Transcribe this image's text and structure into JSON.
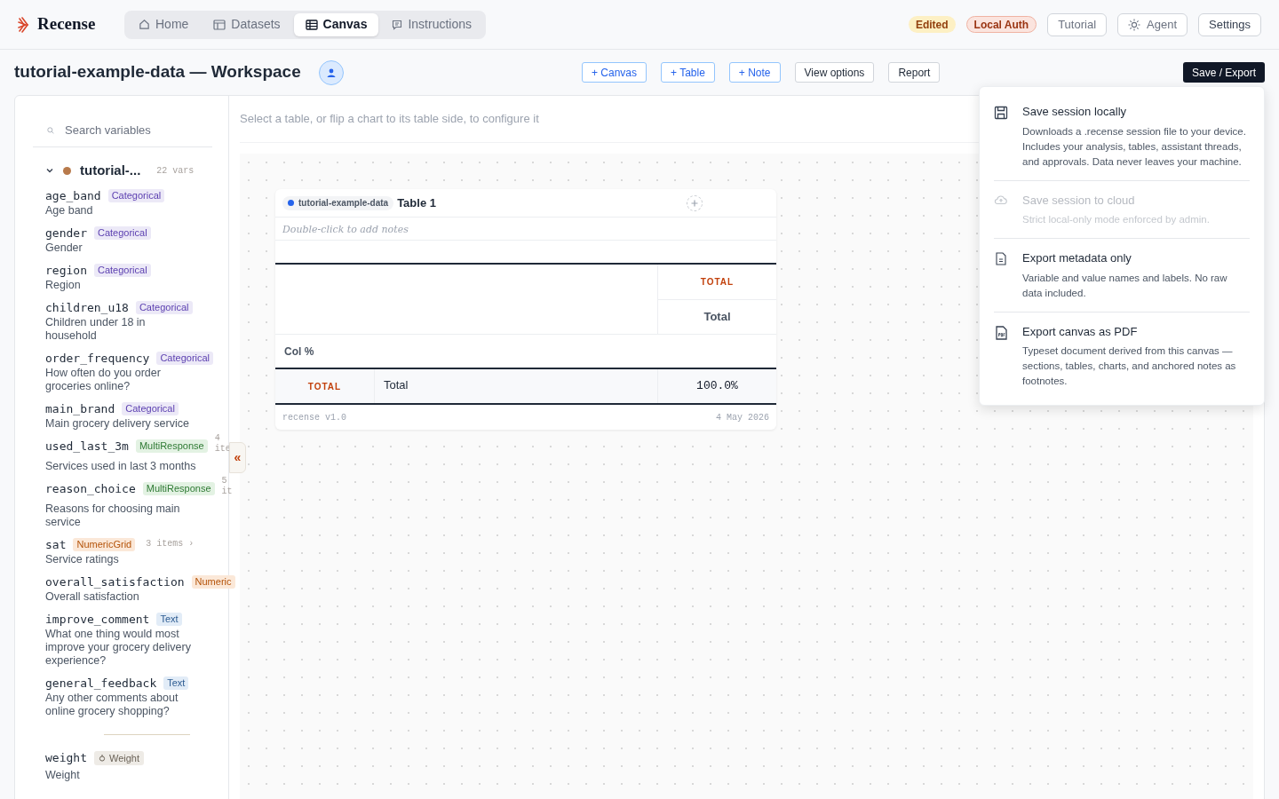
{
  "app": {
    "name": "Recense"
  },
  "nav_tabs": [
    {
      "label": "Home",
      "selected": false
    },
    {
      "label": "Datasets",
      "selected": false
    },
    {
      "label": "Canvas",
      "selected": true
    },
    {
      "label": "Instructions",
      "selected": false
    }
  ],
  "status_badges": [
    {
      "label": "Edited",
      "kind": "warning"
    },
    {
      "label": "Local Auth",
      "kind": "danger"
    }
  ],
  "header_buttons": [
    {
      "label": "Tutorial"
    },
    {
      "label": "Agent"
    },
    {
      "label": "Settings"
    }
  ],
  "workspace": {
    "title": "tutorial-example-data — Workspace"
  },
  "toolbar": [
    {
      "label": "+ Canvas",
      "kind": "add"
    },
    {
      "label": "+ Table",
      "kind": "add"
    },
    {
      "label": "+ Note",
      "kind": "add"
    },
    {
      "label": "View options",
      "kind": "plain"
    },
    {
      "label": "Report",
      "kind": "plain"
    }
  ],
  "save_export": {
    "label": "Save / Export"
  },
  "sidebar": {
    "search": {
      "placeholder": "Search variables"
    },
    "dataset": {
      "name": "tutorial-...",
      "count": "22 vars",
      "color": "#b87a4b",
      "expanded": true
    },
    "variables": [
      {
        "name": "age_band",
        "type": "Categorical",
        "label": "Age band"
      },
      {
        "name": "gender",
        "type": "Categorical",
        "label": "Gender"
      },
      {
        "name": "region",
        "type": "Categorical",
        "label": "Region"
      },
      {
        "name": "children_u18",
        "type": "Categorical",
        "label": "Children under 18 in household"
      },
      {
        "name": "order_frequency",
        "type": "Categorical",
        "label": "How often do you order groceries online?"
      },
      {
        "name": "main_brand",
        "type": "Categorical",
        "label": "Main grocery delivery service"
      },
      {
        "name": "used_last_3m",
        "type": "MultiResponse",
        "label": "Services used in last 3 months",
        "items": "4 ite"
      },
      {
        "name": "reason_choice",
        "type": "MultiResponse",
        "label": "Reasons for choosing main service",
        "items": "5 it"
      },
      {
        "name": "sat",
        "type": "NumericGrid",
        "label": "Service ratings",
        "items": "3 items ›"
      },
      {
        "name": "overall_satisfaction",
        "type": "Numeric",
        "label": "Overall satisfaction"
      },
      {
        "name": "improve_comment",
        "type": "Text",
        "label": "What one thing would most improve your grocery delivery experience?"
      },
      {
        "name": "general_feedback",
        "type": "Text",
        "label": "Any other comments about online grocery shopping?"
      }
    ],
    "weight": {
      "name": "weight",
      "badge": "Weight",
      "label": "Weight"
    },
    "collapse": {
      "label": "«"
    }
  },
  "canvas": {
    "hint": "Select a table, or flip a chart to its table side, to configure it",
    "table_card": {
      "source": "tutorial-example-data",
      "title": "Table 1",
      "notes": {
        "placeholder": "Double-click to add notes"
      },
      "column_group": "TOTAL",
      "column": "Total",
      "statistic": "Col %",
      "row_group": "TOTAL",
      "row": "Total",
      "value": "100.0%",
      "footer_left": "recense v1.0",
      "footer_right": "4 May 2026"
    }
  },
  "export_menu": [
    {
      "kind": "save",
      "title": "Save session locally",
      "description": "Downloads a .recense session file to your device. Includes your analysis, tables, assistant threads, and approvals. Data never leaves your machine.",
      "disabled": false
    },
    {
      "kind": "cloud",
      "title": "Save session to cloud",
      "description": "Strict local-only mode enforced by admin.",
      "disabled": true
    },
    {
      "kind": "metadata",
      "title": "Export metadata only",
      "description": "Variable and value names and labels. No raw data included.",
      "disabled": false
    },
    {
      "kind": "pdf",
      "title": "Export canvas as PDF",
      "description": "Typeset document derived from this canvas — sections, tables, charts, and anchored notes as footnotes.",
      "disabled": false
    }
  ]
}
